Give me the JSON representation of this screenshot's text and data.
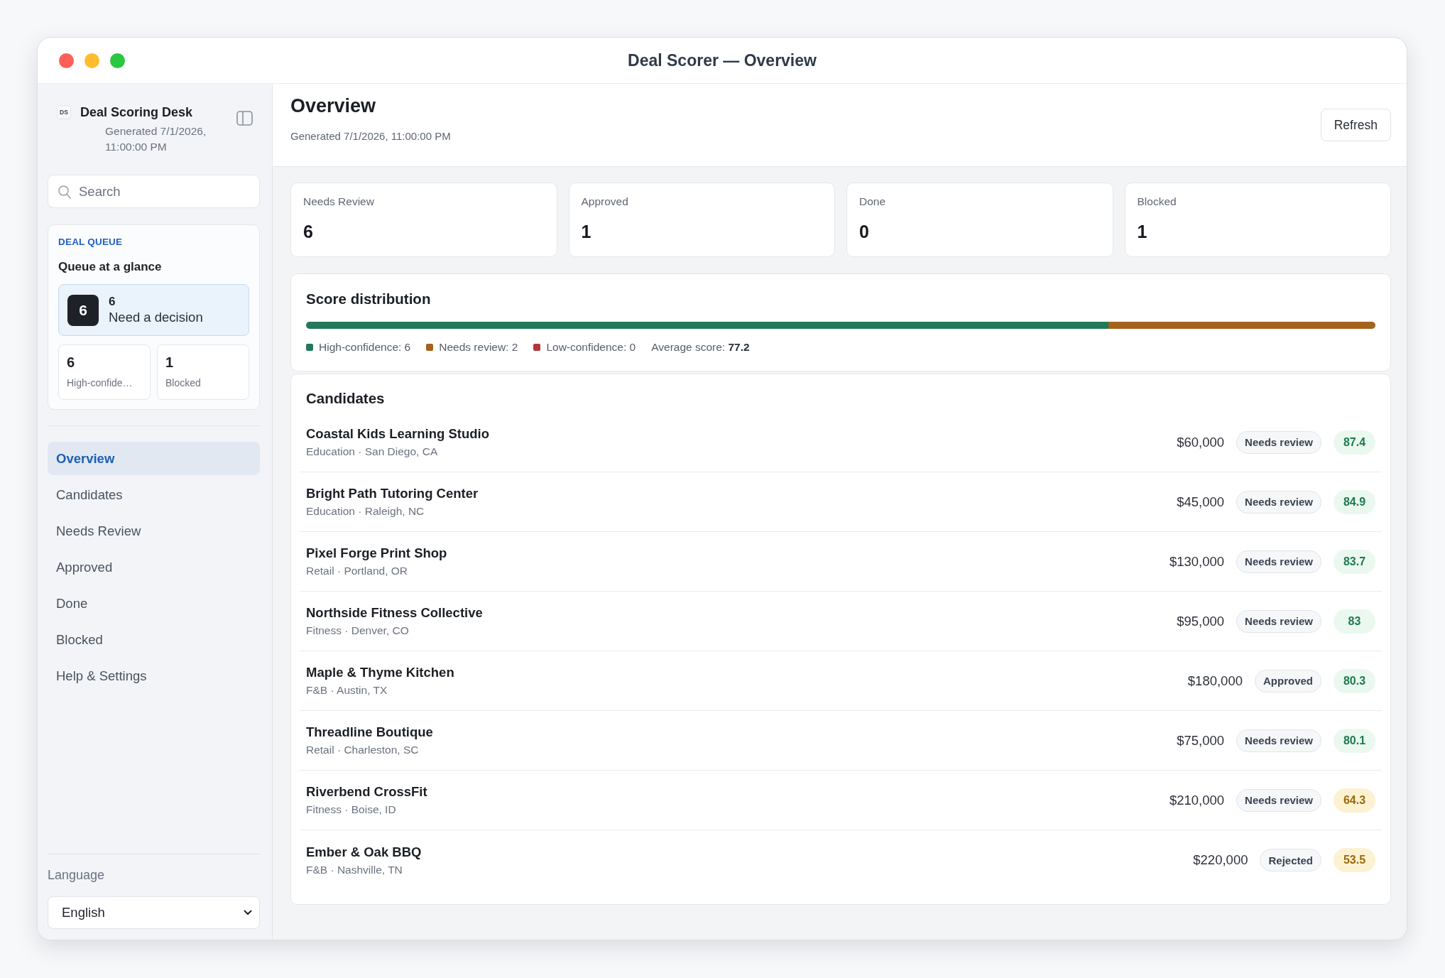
{
  "window": {
    "title": "Deal Scorer — Overview"
  },
  "sidebar": {
    "brand": {
      "logo": "DS",
      "name": "Deal Scoring Desk",
      "generated": "Generated 7/1/2026, 11:00:00 PM"
    },
    "search": {
      "placeholder": "Search"
    },
    "queue": {
      "eyebrow": "DEAL QUEUE",
      "title": "Queue at a glance",
      "highlight": {
        "badge": "6",
        "count": "6",
        "label": "Need a decision"
      },
      "stats": [
        {
          "value": "6",
          "label": "High-confide…"
        },
        {
          "value": "1",
          "label": "Blocked"
        }
      ]
    },
    "nav": [
      {
        "label": "Overview",
        "selected": true
      },
      {
        "label": "Candidates",
        "selected": false
      },
      {
        "label": "Needs Review",
        "selected": false
      },
      {
        "label": "Approved",
        "selected": false
      },
      {
        "label": "Done",
        "selected": false
      },
      {
        "label": "Blocked",
        "selected": false
      },
      {
        "label": "Help & Settings",
        "selected": false
      }
    ],
    "language": {
      "label": "Language",
      "value": "English"
    }
  },
  "header": {
    "title": "Overview",
    "subtitle": "Generated 7/1/2026, 11:00:00 PM",
    "refresh": "Refresh"
  },
  "stats": [
    {
      "label": "Needs Review",
      "value": "6"
    },
    {
      "label": "Approved",
      "value": "1"
    },
    {
      "label": "Done",
      "value": "0"
    },
    {
      "label": "Blocked",
      "value": "1"
    }
  ],
  "score_distribution": {
    "title": "Score distribution",
    "segments": [
      {
        "label": "High-confidence: 6",
        "color": "#23795a",
        "level": 0.75
      },
      {
        "label": "Needs review: 2",
        "color": "#a5621c",
        "level": 0.25
      },
      {
        "label": "Low-confidence: 0",
        "color": "#b3363b"
      }
    ],
    "average": "Average score: **77.2**"
  },
  "candidates": {
    "title": "Candidates",
    "rows": [
      {
        "name": "Coastal Kids Learning Studio",
        "meta": "Education · San Diego, CA",
        "amount": "$60,000",
        "status": "Needs review",
        "score": "87.4",
        "high_confidence": true
      },
      {
        "name": "Bright Path Tutoring Center",
        "meta": "Education · Raleigh, NC",
        "amount": "$45,000",
        "status": "Needs review",
        "score": "84.9",
        "high_confidence": true
      },
      {
        "name": "Pixel Forge Print Shop",
        "meta": "Retail · Portland, OR",
        "amount": "$130,000",
        "status": "Needs review",
        "score": "83.7",
        "high_confidence": true
      },
      {
        "name": "Northside Fitness Collective",
        "meta": "Fitness · Denver, CO",
        "amount": "$95,000",
        "status": "Needs review",
        "score": "83",
        "high_confidence": true
      },
      {
        "name": "Maple & Thyme Kitchen",
        "meta": "F&B · Austin, TX",
        "amount": "$180,000",
        "status": "Approved",
        "score": "80.3",
        "high_confidence": true
      },
      {
        "name": "Threadline Boutique",
        "meta": "Retail · Charleston, SC",
        "amount": "$75,000",
        "status": "Needs review",
        "score": "80.1",
        "high_confidence": true
      },
      {
        "name": "Riverbend CrossFit",
        "meta": "Fitness · Boise, ID",
        "amount": "$210,000",
        "status": "Needs review",
        "score": "64.3",
        "high_confidence": false
      },
      {
        "name": "Ember & Oak BBQ",
        "meta": "F&B · Nashville, TN",
        "amount": "$220,000",
        "status": "Rejected",
        "score": "53.5",
        "high_confidence": false
      }
    ]
  }
}
